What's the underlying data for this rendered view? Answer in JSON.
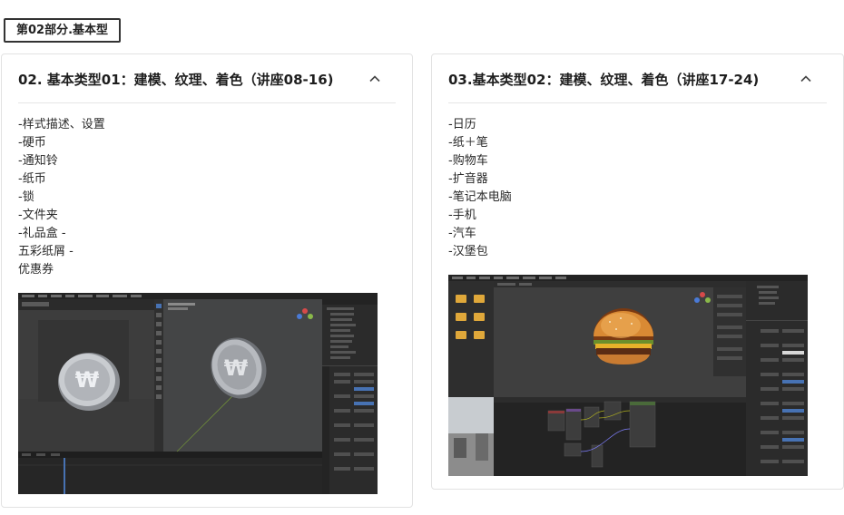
{
  "section_tag": "第02部分.基本型",
  "cards": [
    {
      "title": "02. 基本类型01：建模、纹理、着色（讲座08-16)",
      "items": [
        "-样式描述、设置",
        "-硬币",
        "-通知铃",
        "-纸币",
        "-锁",
        "-文件夹",
        "-礼品盒 -",
        "五彩纸屑 -",
        "优惠券"
      ],
      "screenshot": {
        "name": "blender-coin-screenshot",
        "icon": "won-coin"
      }
    },
    {
      "title": "03.基本类型02：建模、纹理、着色（讲座17-24)",
      "items": [
        "-日历",
        "-纸＋笔",
        "-购物车",
        "-扩音器",
        "-笔记本电脑",
        "-手机",
        "-汽车",
        "-汉堡包"
      ],
      "screenshot": {
        "name": "blender-burger-screenshot",
        "icon": "hamburger"
      }
    }
  ],
  "colors": {
    "border": "#e2e2e2",
    "title": "#1e1e1e",
    "blender_bg": "#3a3a3a",
    "blender_panel": "#2b2b2b",
    "accent_blue": "#4772b3"
  }
}
